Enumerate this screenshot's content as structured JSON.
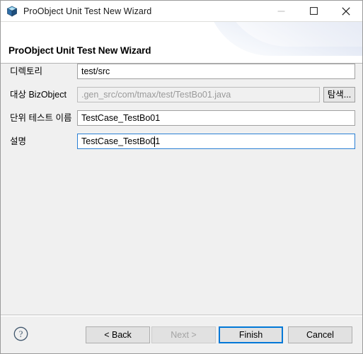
{
  "window": {
    "title": "ProObject Unit Test New Wizard",
    "icon": "cube-icon",
    "controls": {
      "minimize": "minimize-icon",
      "maximize": "maximize-icon",
      "close": "close-icon"
    }
  },
  "header": {
    "title": "ProObject Unit Test New Wizard"
  },
  "form": {
    "fields": [
      {
        "label": "디렉토리",
        "value": "test/src",
        "state": "editable",
        "has_browse": false
      },
      {
        "label": "대상 BizObject",
        "value": ".gen_src/com/tmax/test/TestBo01.java",
        "state": "readonly",
        "has_browse": true,
        "browse_label": "탐색..."
      },
      {
        "label": "단위 테스트 이름",
        "value": "TestCase_TestBo01",
        "state": "editable",
        "has_browse": false
      },
      {
        "label": "설명",
        "value": "TestCase_TestBo01",
        "state": "focused",
        "has_browse": false
      }
    ]
  },
  "footer": {
    "help_icon": "help-question-icon",
    "buttons": [
      {
        "label": "< Back",
        "state": "enabled",
        "name": "back-button"
      },
      {
        "label": "Next >",
        "state": "disabled",
        "name": "next-button"
      },
      {
        "label": "Finish",
        "state": "default",
        "name": "finish-button"
      },
      {
        "label": "Cancel",
        "state": "enabled",
        "name": "cancel-button"
      }
    ]
  },
  "colors": {
    "accent": "#0078d7",
    "focus_border": "#2a7fd4",
    "dialog_bg": "#f0f0f0",
    "banner_bg": "#ffffff",
    "disabled_text": "#a3a3a3",
    "readonly_text": "#9a9a9a"
  }
}
